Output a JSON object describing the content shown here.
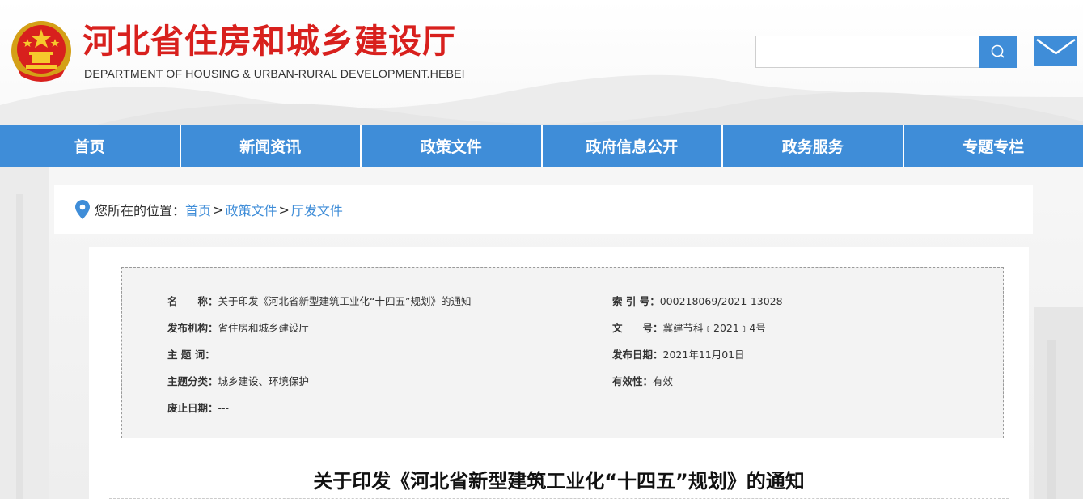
{
  "header": {
    "title": "河北省住房和城乡建设厅",
    "subtitle": "DEPARTMENT OF HOUSING & URBAN-RURAL DEVELOPMENT.HEBEI",
    "search_placeholder": "",
    "search_icon": "search-icon",
    "mail_icon": "mail-icon"
  },
  "nav": {
    "items": [
      "首页",
      "新闻资讯",
      "政策文件",
      "政府信息公开",
      "政务服务",
      "专题专栏"
    ]
  },
  "breadcrumb": {
    "prefix": "您所在的位置：",
    "links": [
      "首页",
      "政策文件",
      "厅发文件"
    ],
    "separator": ">"
  },
  "meta": {
    "name_label": "名　　称：",
    "name_value": "关于印发《河北省新型建筑工业化“十四五”规划》的通知",
    "index_label": "索 引 号：",
    "index_value": "000218069/2021-13028",
    "org_label": "发布机构：",
    "org_value": "省住房和城乡建设厅",
    "docno_label": "文　　号：",
    "docno_value": "冀建节科﹝2021﹞4号",
    "keywords_label": "主 题 词：",
    "keywords_value": "",
    "date_label": "发布日期：",
    "date_value": "2021年11月01日",
    "category_label": "主题分类：",
    "category_value": "城乡建设、环境保护",
    "validity_label": "有效性：",
    "validity_value": "有效",
    "abolish_label": "废止日期：",
    "abolish_value": "---"
  },
  "article": {
    "title": "关于印发《河北省新型建筑工业化“十四五”规划》的通知"
  },
  "colors": {
    "brand_blue": "#3f8dd8",
    "title_red": "#d8201d"
  }
}
